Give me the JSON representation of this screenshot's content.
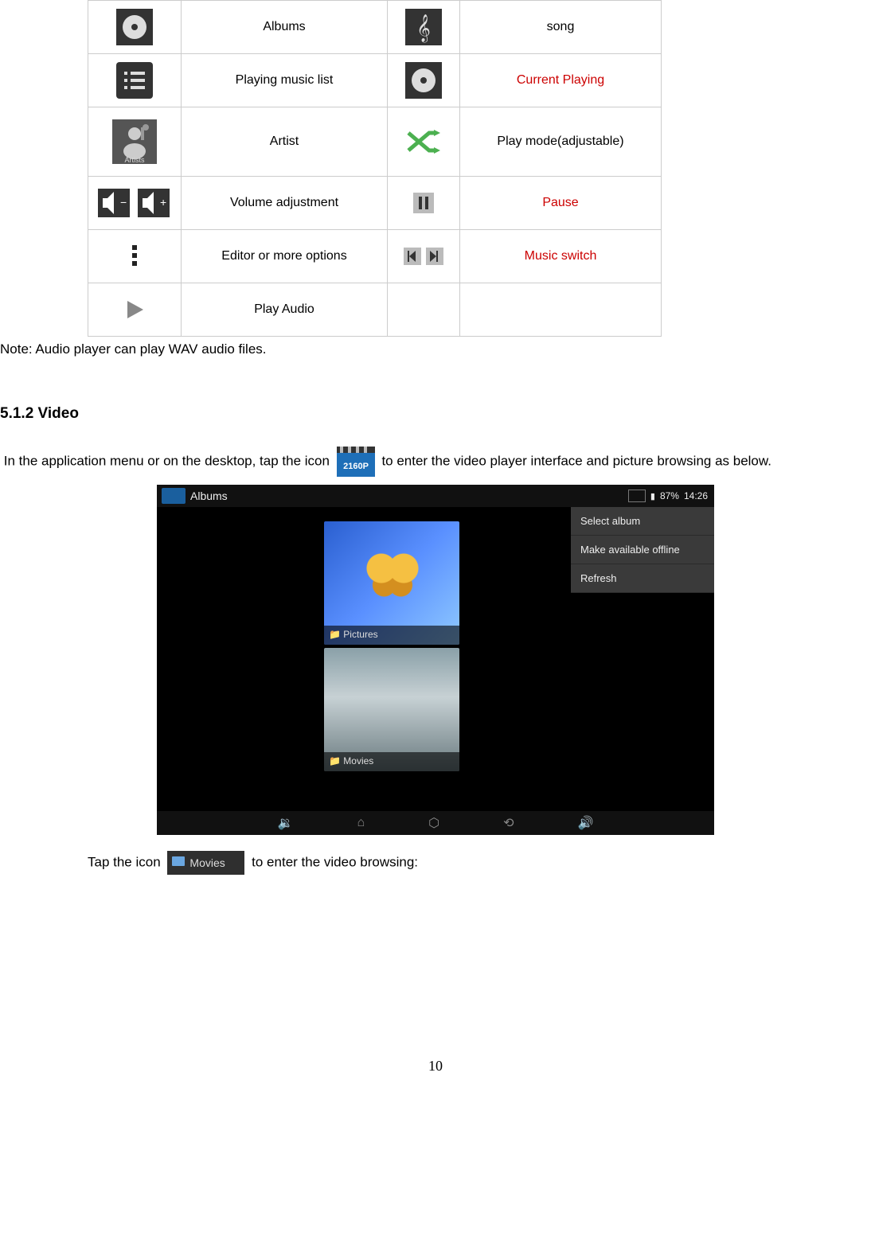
{
  "table": {
    "rows": [
      {
        "left": "Albums",
        "right": "song",
        "rightRed": false,
        "iconL": "albums",
        "iconR": "treble"
      },
      {
        "left": "Playing music list",
        "right": "Current Playing",
        "rightRed": true,
        "iconL": "list",
        "iconR": "albums"
      },
      {
        "left": "Artist",
        "right": "Play mode(adjustable)",
        "rightRed": false,
        "iconL": "artist",
        "iconR": "shuffle",
        "tall": true
      },
      {
        "left": "Volume adjustment",
        "right": "Pause",
        "rightRed": true,
        "iconL": "volume",
        "iconR": "pause"
      },
      {
        "left": "Editor or more options",
        "right": "Music switch",
        "rightRed": true,
        "iconL": "more",
        "iconR": "prevnext"
      },
      {
        "left": "Play Audio",
        "right": "",
        "rightRed": false,
        "iconL": "play",
        "iconR": "",
        "short": true
      }
    ]
  },
  "note": "Note: Audio player can play WAV audio files.",
  "section_heading": "5.1.2 Video",
  "para1_a": "In the application menu or on the desktop, tap the icon",
  "para1_b": "to enter the video player interface and picture browsing as below.",
  "screenshot": {
    "title": "Albums",
    "battery": "87%",
    "time": "14:26",
    "folder1": "Pictures",
    "folder2": "Movies",
    "menu": [
      "Select album",
      "Make available offline",
      "Refresh"
    ]
  },
  "tap_a": "Tap the icon",
  "tap_b": "to enter the video browsing:",
  "movies_label": "Movies",
  "page_number": "10"
}
